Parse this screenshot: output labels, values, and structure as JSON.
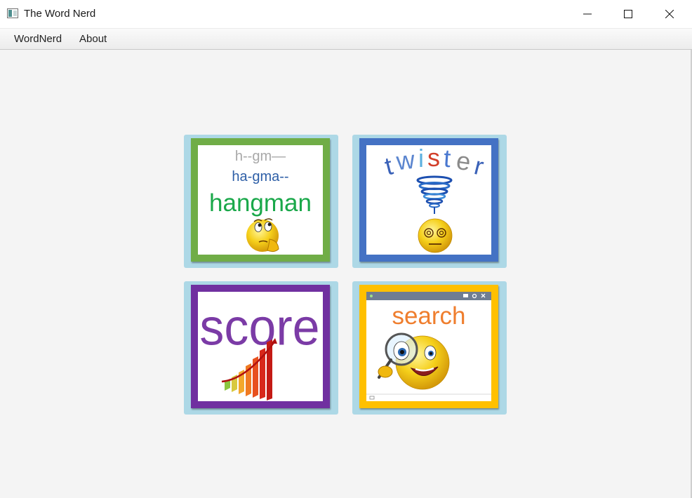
{
  "window": {
    "title": "The Word Nerd",
    "icon": "app-window-icon",
    "controls": [
      "minimize-icon",
      "maximize-icon",
      "close-icon"
    ]
  },
  "menu": {
    "items": [
      {
        "label": "WordNerd"
      },
      {
        "label": "About"
      }
    ]
  },
  "tiles": {
    "hangman": {
      "lines": [
        "h--gm—",
        "ha-gma--",
        "hangman"
      ],
      "border_color": "#70ad47",
      "icon": "thinking-emoji-icon"
    },
    "twister": {
      "letters": [
        "t",
        "w",
        "i",
        "s",
        "t",
        "e",
        "r"
      ],
      "border_color": "#4472c4",
      "icon": "dizzy-emoji-tornado-icon"
    },
    "score": {
      "label": "score",
      "border_color": "#7030a0",
      "icon": "growth-bar-chart-icon"
    },
    "search": {
      "label": "search",
      "border_color": "#ffc000",
      "icon": "magnifying-glass-emoji-icon"
    }
  },
  "colors": {
    "tile_background": "#add8e6",
    "page_background": "#f4f4f4"
  }
}
